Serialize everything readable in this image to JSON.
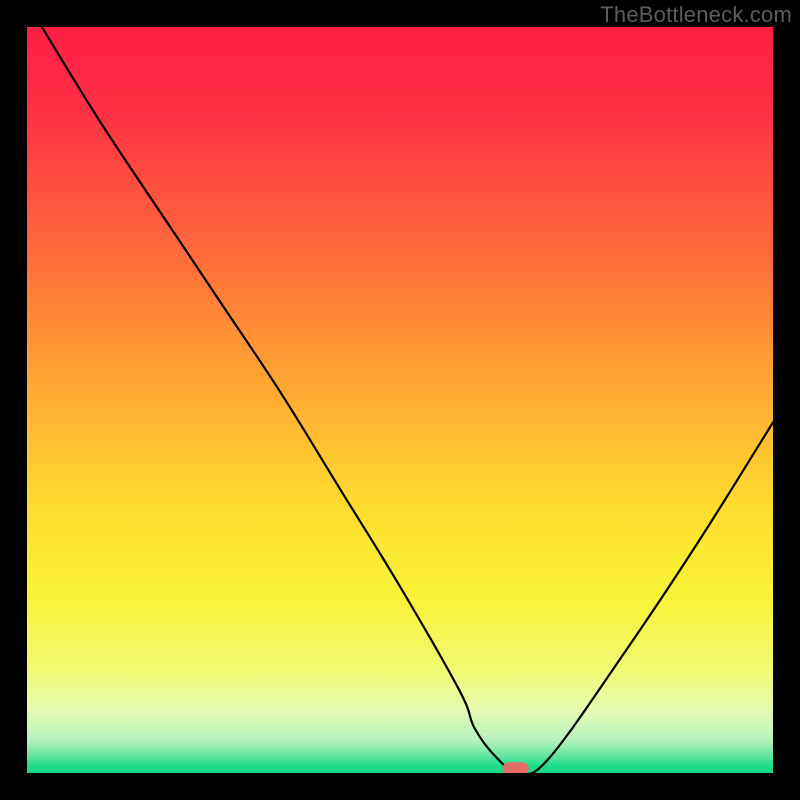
{
  "watermark": "TheBottleneck.com",
  "chart_data": {
    "type": "line",
    "title": "",
    "xlabel": "",
    "ylabel": "",
    "xlim": [
      0,
      100
    ],
    "ylim": [
      0,
      100
    ],
    "grid": false,
    "legend": false,
    "background_gradient_stops": [
      {
        "pos": 0.0,
        "color": "#ff1e46"
      },
      {
        "pos": 0.12,
        "color": "#ff3243"
      },
      {
        "pos": 0.3,
        "color": "#ff6a3b"
      },
      {
        "pos": 0.48,
        "color": "#ffa733"
      },
      {
        "pos": 0.64,
        "color": "#ffdc2e"
      },
      {
        "pos": 0.76,
        "color": "#f8f335"
      },
      {
        "pos": 0.86,
        "color": "#f1fa70"
      },
      {
        "pos": 0.915,
        "color": "#e6fab0"
      },
      {
        "pos": 0.955,
        "color": "#b8f3be"
      },
      {
        "pos": 0.975,
        "color": "#6be6a3"
      },
      {
        "pos": 0.99,
        "color": "#1fdd8b"
      },
      {
        "pos": 1.0,
        "color": "#18d987"
      }
    ],
    "series": [
      {
        "name": "bottleneck-curve",
        "x": [
          2,
          10,
          20,
          26,
          34,
          42,
          50,
          58,
          60,
          63,
          66,
          70,
          80,
          90,
          100
        ],
        "y": [
          100,
          87,
          72,
          63,
          51,
          38,
          25,
          11,
          6,
          2,
          0,
          2,
          16,
          31,
          47
        ]
      }
    ],
    "marker": {
      "name": "minimum-pill",
      "x": 65.5,
      "y": 0.5,
      "color": "#e46d6a"
    }
  }
}
